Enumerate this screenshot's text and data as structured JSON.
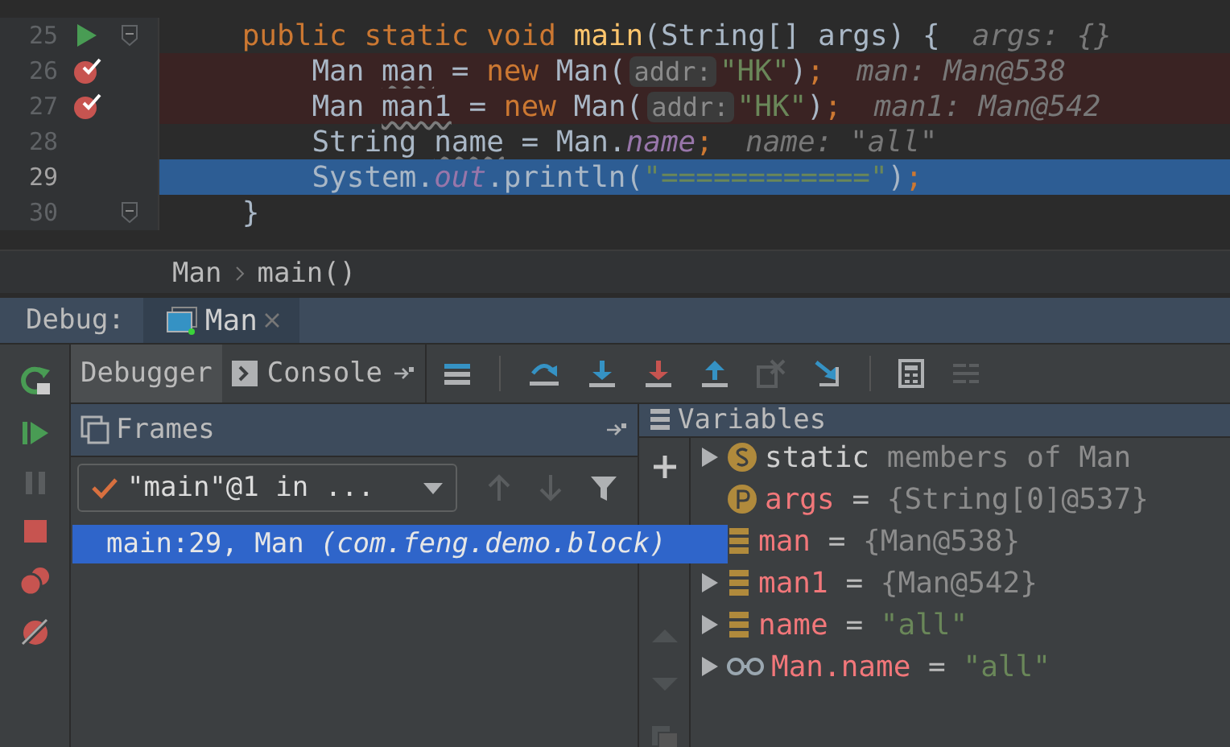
{
  "editor": {
    "lines": [
      {
        "number": "25",
        "breakpoint": false,
        "current": false,
        "run_marker": true,
        "fold": true,
        "tokens": [
          {
            "kind": "kw",
            "text": "    public static void "
          },
          {
            "kind": "method",
            "text": "main"
          },
          {
            "kind": "plain",
            "text": "(String[] args) {"
          },
          {
            "kind": "hint",
            "text": "args: {}"
          }
        ]
      },
      {
        "number": "26",
        "breakpoint": true,
        "current": false,
        "run_marker": false,
        "fold": false,
        "tokens": [
          {
            "kind": "plain",
            "text": "        Man "
          },
          {
            "kind": "unused",
            "text": "man"
          },
          {
            "kind": "plain",
            "text": " = "
          },
          {
            "kind": "kw",
            "text": "new"
          },
          {
            "kind": "plain",
            "text": " Man("
          },
          {
            "kind": "param",
            "text": "addr:"
          },
          {
            "kind": "str",
            "text": "\"HK\""
          },
          {
            "kind": "plain",
            "text": ")"
          },
          {
            "kind": "kw",
            "text": ";"
          },
          {
            "kind": "hint",
            "text": "man: Man@538"
          }
        ]
      },
      {
        "number": "27",
        "breakpoint": true,
        "current": false,
        "run_marker": false,
        "fold": false,
        "tokens": [
          {
            "kind": "plain",
            "text": "        Man "
          },
          {
            "kind": "unused",
            "text": "man1"
          },
          {
            "kind": "plain",
            "text": " = "
          },
          {
            "kind": "kw",
            "text": "new"
          },
          {
            "kind": "plain",
            "text": " Man("
          },
          {
            "kind": "param",
            "text": "addr:"
          },
          {
            "kind": "str",
            "text": "\"HK\""
          },
          {
            "kind": "plain",
            "text": ")"
          },
          {
            "kind": "kw",
            "text": ";"
          },
          {
            "kind": "hint",
            "text": "man1: Man@542"
          }
        ]
      },
      {
        "number": "28",
        "breakpoint": false,
        "current": false,
        "run_marker": false,
        "fold": false,
        "tokens": [
          {
            "kind": "plain",
            "text": "        String "
          },
          {
            "kind": "unused",
            "text": "name"
          },
          {
            "kind": "plain",
            "text": " = Man."
          },
          {
            "kind": "field",
            "text": "name"
          },
          {
            "kind": "kw",
            "text": ";"
          },
          {
            "kind": "hint",
            "text": "name: \"all\""
          }
        ]
      },
      {
        "number": "29",
        "breakpoint": false,
        "current": true,
        "run_marker": false,
        "fold": false,
        "tokens": [
          {
            "kind": "plain",
            "text": "        System."
          },
          {
            "kind": "field",
            "text": "out"
          },
          {
            "kind": "plain",
            "text": ".println("
          },
          {
            "kind": "str",
            "text": "\"============\""
          },
          {
            "kind": "plain",
            "text": ")"
          },
          {
            "kind": "kw",
            "text": ";"
          }
        ]
      },
      {
        "number": "30",
        "breakpoint": false,
        "current": false,
        "run_marker": false,
        "fold": true,
        "tokens": [
          {
            "kind": "plain",
            "text": "    }"
          }
        ]
      }
    ]
  },
  "breadcrumbs": [
    "Man",
    "main()"
  ],
  "debug": {
    "title": "Debug:",
    "sessions": [
      {
        "label": "Man",
        "selected": true
      }
    ]
  },
  "tabs": [
    {
      "label": "Debugger",
      "selected": true
    },
    {
      "label": "Console",
      "selected": false
    }
  ],
  "frames": {
    "title": "Frames",
    "thread": "\"main\"@1 in ...",
    "items": [
      {
        "method": "main:29, Man",
        "package": "(com.feng.demo.block)",
        "selected": true
      }
    ]
  },
  "variables": {
    "title": "Variables",
    "items": [
      {
        "kind": "static",
        "name": "static",
        "value": {
          "kind": "plain",
          "text": "members of Man"
        }
      },
      {
        "kind": "param",
        "name": "args",
        "separator": "=",
        "value": {
          "kind": "object",
          "text": "{String[0]@537}"
        }
      },
      {
        "kind": "local",
        "name": "man",
        "separator": "=",
        "value": {
          "kind": "object",
          "text": "{Man@538}"
        }
      },
      {
        "kind": "local",
        "name": "man1",
        "separator": "=",
        "value": {
          "kind": "object",
          "text": "{Man@542}"
        }
      },
      {
        "kind": "local",
        "name": "name",
        "separator": "=",
        "value": {
          "kind": "string",
          "text": "\"all\""
        }
      },
      {
        "kind": "watch",
        "name": "Man.name",
        "separator": "=",
        "value": {
          "kind": "string",
          "text": "\"all\""
        }
      }
    ]
  }
}
